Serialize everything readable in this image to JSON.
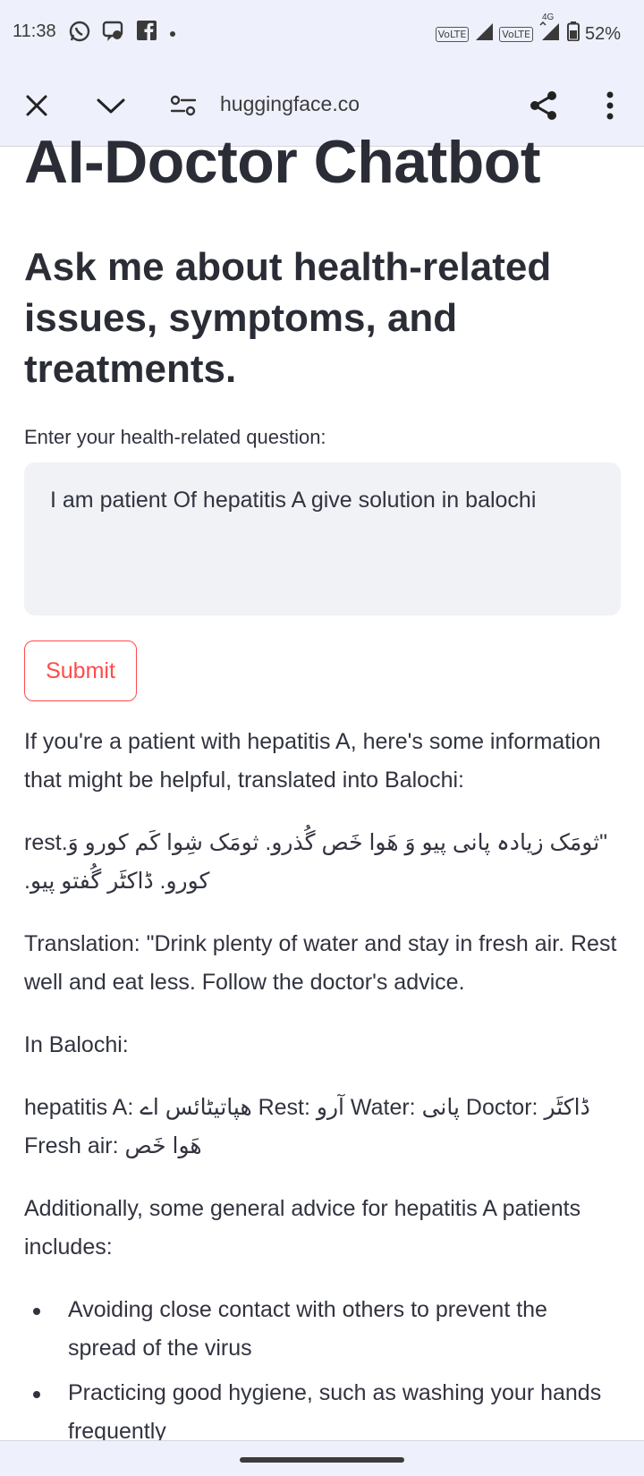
{
  "status_bar": {
    "time": "11:38",
    "apps": [
      "whatsapp-icon",
      "chat-icon",
      "facebook-icon",
      "dot-icon"
    ],
    "volte_1": "VoLTE",
    "volte_2": "VoLTE",
    "network": "4G",
    "battery": "52%"
  },
  "browser": {
    "url": "huggingface.co",
    "icons": [
      "close-icon",
      "chevron-down-icon",
      "site-settings-icon",
      "share-icon",
      "more-vert-icon"
    ]
  },
  "page": {
    "title": "AI-Doctor Chatbot",
    "subtitle": "Ask me about health-related issues, symptoms, and treatments.",
    "input_label": "Enter your health-related question:",
    "question": "I am patient Of hepatitis A give solution in balochi",
    "submit_label": "Submit"
  },
  "response": {
    "intro": "If you're a patient with hepatitis A, here's some information that might be helpful, translated into Balochi:",
    "balochi_advice": "\"ثومَک زیادہ پانی پیو وَ ھَوا خَص گُذرو. ثومَک شِوا کَم کورو وَ.rest کورو. ڈاکٹَر گُفتو پیو.",
    "translation": "Translation: \"Drink plenty of water and stay in fresh air. Rest well and eat less. Follow the doctor's advice.",
    "balochi_heading": "In Balochi:",
    "glossary": "hepatitis A: ھپاتیٹائس اے Rest: آرو Water: پانی Doctor: ڈاکٹَر Fresh air: ھَوا خَص",
    "general_intro": "Additionally, some general advice for hepatitis A patients includes:",
    "bullets": [
      "Avoiding close contact with others to prevent the spread of the virus",
      "Practicing good hygiene, such as washing your hands frequently"
    ]
  }
}
